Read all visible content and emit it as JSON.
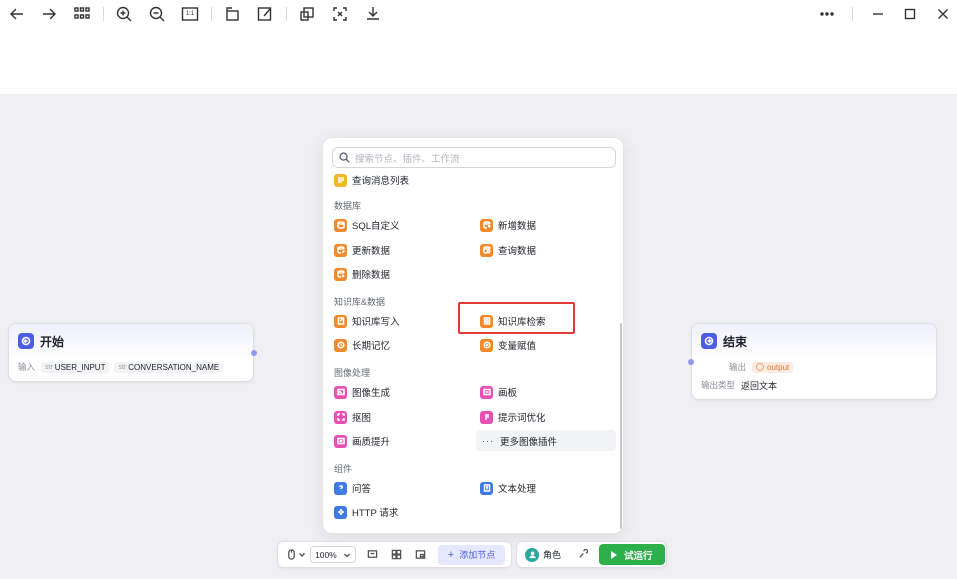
{
  "toolbar": {
    "zoom_reset_label": "1:1",
    "icons": [
      "arrow-left-icon",
      "arrow-right-icon",
      "grid-icon",
      "zoom-in-icon",
      "zoom-out-icon",
      "actual-size-icon",
      "rotate-icon",
      "edit-icon",
      "copy-icon",
      "fit-screen-icon",
      "download-icon",
      "more-icon",
      "minimize-icon",
      "maximize-icon",
      "close-icon"
    ]
  },
  "start_node": {
    "title": "开始",
    "input_label": "输入",
    "variables": [
      {
        "prefix": "str",
        "name": "USER_INPUT"
      },
      {
        "prefix": "str",
        "name": "CONVERSATION_NAME"
      }
    ]
  },
  "end_node": {
    "title": "结束",
    "output_label": "输出",
    "output_var": "output",
    "output_type_label": "输出类型",
    "output_type_value": "返回文本"
  },
  "panel": {
    "search_placeholder": "搜索节点、插件、工作流",
    "partial_item": "查询消息列表",
    "categories": {
      "database": "数据库",
      "knowledge": "知识库&数据",
      "image": "图像处理",
      "component": "组件"
    },
    "database_items": [
      "SQL自定义",
      "新增数据",
      "更新数据",
      "查询数据",
      "删除数据"
    ],
    "knowledge_items": [
      "知识库写入",
      "知识库检索",
      "长期记忆",
      "变量赋值"
    ],
    "image_items": [
      "图像生成",
      "画板",
      "抠图",
      "提示词优化",
      "画质提升"
    ],
    "more_image_label": "更多图像插件",
    "component_items": [
      "问答",
      "文本处理",
      "HTTP 请求"
    ]
  },
  "bottom_toolbar": {
    "zoom_value": "100%",
    "add_node_label": "添加节点",
    "role_label": "角色",
    "run_label": "试运行"
  },
  "colors": {
    "accent": "#4e5ee4",
    "run_green": "#2db04a",
    "highlight_red": "#e03a3a",
    "orange": "#f08a2c",
    "pink": "#e850b4",
    "blue": "#3f7be8"
  }
}
